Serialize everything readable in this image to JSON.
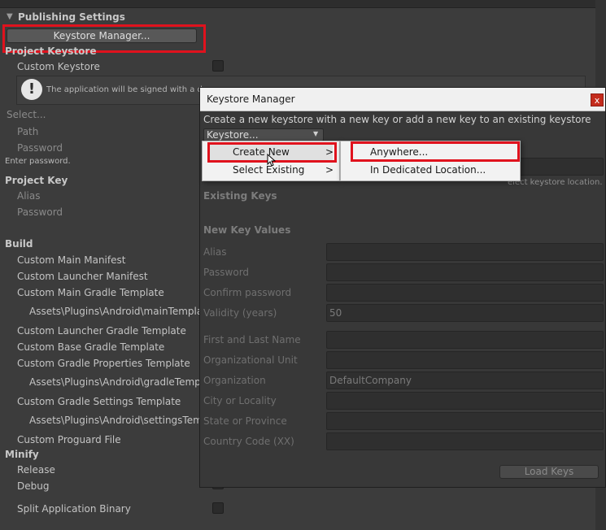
{
  "inspector": {
    "section_title": "Publishing Settings",
    "keystore_manager_btn": "Keystore Manager...",
    "project_keystore_heading": "Project Keystore",
    "custom_keystore": "Custom Keystore",
    "info_text": "The application will be signed with a de",
    "select_placeholder": "Select...",
    "path": "Path",
    "password": "Password",
    "enter_password": "Enter password.",
    "project_key_heading": "Project Key",
    "alias": "Alias",
    "key_password": "Password",
    "build_heading": "Build",
    "custom_main_manifest": "Custom Main Manifest",
    "custom_launcher_manifest": "Custom Launcher Manifest",
    "custom_main_gradle": "Custom Main Gradle Template",
    "main_template_path": "Assets\\Plugins\\Android\\mainTemplate",
    "custom_launcher_gradle": "Custom Launcher Gradle Template",
    "custom_base_gradle": "Custom Base Gradle Template",
    "custom_gradle_props": "Custom Gradle Properties Template",
    "gradle_template_path": "Assets\\Plugins\\Android\\gradleTempla",
    "custom_gradle_settings": "Custom Gradle Settings Template",
    "settings_template_path": "Assets\\Plugins\\Android\\settingsTemp",
    "custom_proguard": "Custom Proguard File",
    "minify_heading": "Minify",
    "release": "Release",
    "debug": "Debug",
    "split_binary": "Split Application Binary"
  },
  "dialog": {
    "title": "Keystore Manager",
    "close_glyph": "x",
    "description": "Create a new keystore with a new key or add a new key to an existing keystore",
    "keystore_dropdown": "Keystore...",
    "hint_location": "elect keystore location.",
    "existing_keys": "Existing Keys",
    "new_key_values": "New Key Values",
    "fields": [
      {
        "label": "Alias",
        "value": ""
      },
      {
        "label": "Password",
        "value": ""
      },
      {
        "label": "Confirm password",
        "value": ""
      },
      {
        "label": "Validity (years)",
        "value": "50"
      },
      {
        "label": "First and Last Name",
        "value": ""
      },
      {
        "label": "Organizational Unit",
        "value": ""
      },
      {
        "label": "Organization",
        "value": "DefaultCompany"
      },
      {
        "label": "City or Locality",
        "value": ""
      },
      {
        "label": "State or Province",
        "value": ""
      },
      {
        "label": "Country Code (XX)",
        "value": ""
      }
    ],
    "load_keys": "Load Keys"
  },
  "context_menu": {
    "items": [
      {
        "label": "Create New",
        "submenu_glyph": ">"
      },
      {
        "label": "Select Existing",
        "submenu_glyph": ">"
      }
    ],
    "submenu": [
      "Anywhere...",
      "In Dedicated Location..."
    ]
  },
  "icons": {
    "foldout": "triangle-down-icon",
    "warning": "exclamation-icon",
    "dropdown": "caret-down-icon",
    "cursor": "mouse-cursor-icon"
  },
  "colors": {
    "highlight_box": "#e0121d",
    "panel_bg": "#3c3c3c",
    "menu_bg": "#f2f2f2"
  }
}
